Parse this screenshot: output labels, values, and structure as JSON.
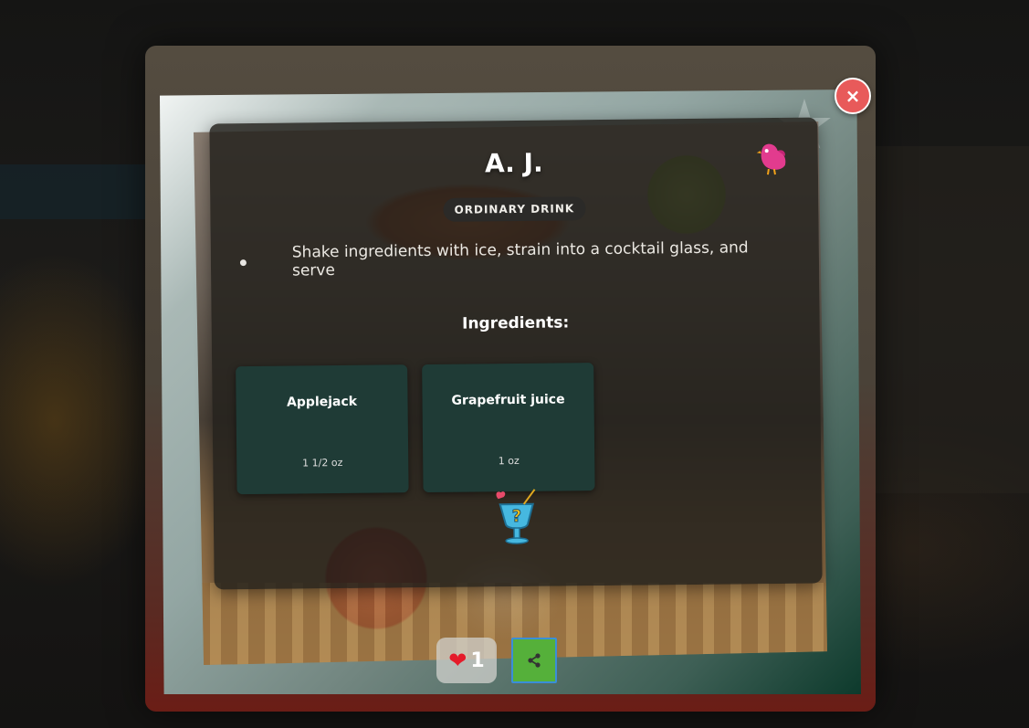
{
  "modal": {
    "close_label": "×",
    "drink": {
      "name": "A. J.",
      "category": "ORDINARY DRINK",
      "instructions": [
        "Shake ingredients with ice, strain into a cocktail glass, and serve"
      ],
      "ingredients_title": "Ingredients:",
      "ingredients": [
        {
          "name": "Applejack",
          "measure": "1 1/2 oz"
        },
        {
          "name": "Grapefruit juice",
          "measure": "1 oz"
        }
      ]
    },
    "actions": {
      "likes_count": "1",
      "like_icon": "heart-icon",
      "share_icon": "share-icon"
    }
  },
  "colors": {
    "close_button": "#e85a5a",
    "like_heart": "#e51b2a",
    "share_button": "#55b03a",
    "ingredient_card": "#1f3b36"
  }
}
